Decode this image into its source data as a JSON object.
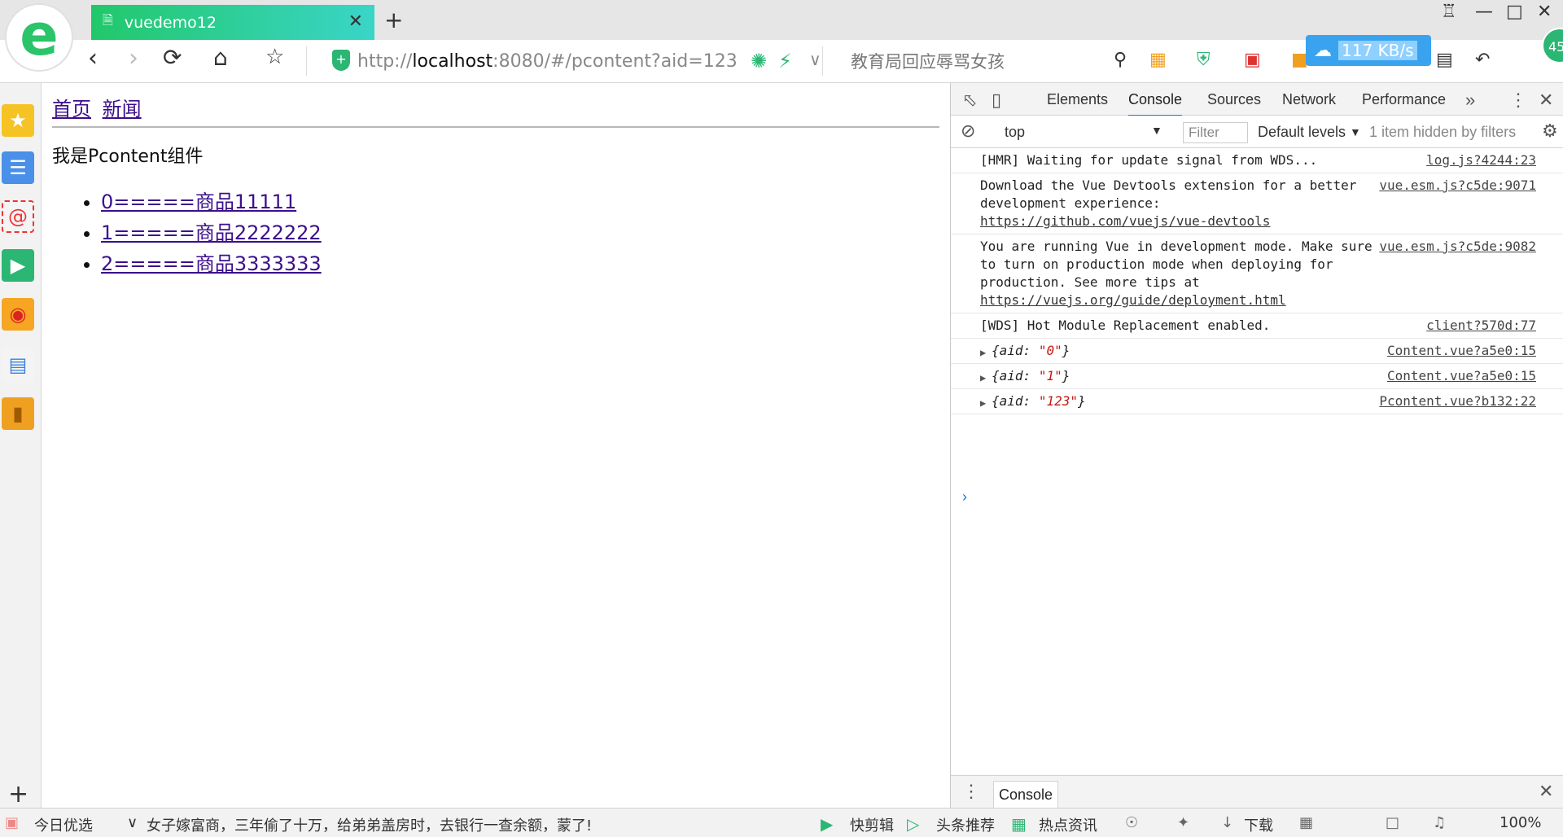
{
  "browser": {
    "logo_letter": "e",
    "tab_title": "vuedemo12",
    "address": {
      "scheme": "http://",
      "host": "localhost",
      "rest": ":8080/#/pcontent?aid=123"
    },
    "search_text": "教育局回应辱骂女孩",
    "speed": "117 KB/s",
    "badge": "45"
  },
  "page": {
    "nav": [
      "首页",
      "新闻"
    ],
    "component_title": "我是Pcontent组件",
    "items": [
      "0=====商品11111",
      "1=====商品2222222",
      "2=====商品3333333"
    ]
  },
  "devtools": {
    "tabs": [
      "Elements",
      "Console",
      "Sources",
      "Network",
      "Performance"
    ],
    "context": "top",
    "filter_placeholder": "Filter",
    "levels": "Default levels",
    "hidden_note": "1 item hidden by filters",
    "messages": [
      {
        "text": "[HMR] Waiting for update signal from WDS...",
        "src": "log.js?4244:23"
      },
      {
        "text": "Download the Vue Devtools extension for a better development experience:",
        "link": "https://github.com/vuejs/vue-devtools",
        "src": "vue.esm.js?c5de:9071"
      },
      {
        "text": "You are running Vue in development mode. Make sure to turn on production mode when deploying for production. See more tips at",
        "link": "https://vuejs.org/guide/deployment.html",
        "src": "vue.esm.js?c5de:9082"
      },
      {
        "text": "[WDS] Hot Module Replacement enabled.",
        "src": "client?570d:77"
      }
    ],
    "objects": [
      {
        "key": "aid",
        "value": "\"0\"",
        "src": "Content.vue?a5e0:15"
      },
      {
        "key": "aid",
        "value": "\"1\"",
        "src": "Content.vue?a5e0:15"
      },
      {
        "key": "aid",
        "value": "\"123\"",
        "src": "Pcontent.vue?b132:22"
      }
    ],
    "drawer_tab": "Console"
  },
  "statusbar": {
    "today": "今日优选",
    "news": "女子嫁富商，三年偷了十万，给弟弟盖房时，去银行一查余额，蒙了!",
    "quick_cut": "快剪辑",
    "headline": "头条推荐",
    "hot": "热点资讯",
    "download": "下载",
    "zoom": "100%"
  }
}
